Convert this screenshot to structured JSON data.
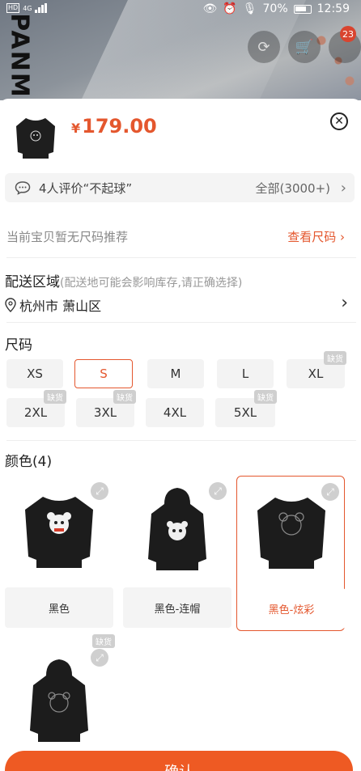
{
  "status_bar": {
    "hd": "HD",
    "network": "4G",
    "battery_percent": "70%",
    "time": "12:59"
  },
  "banner": {
    "brand_text": "PANM",
    "cart_badge": "23"
  },
  "product": {
    "currency": "¥",
    "price": "179.00"
  },
  "review": {
    "text": "4人评价“不起球”",
    "all_label": "全部(3000+)"
  },
  "size_recommend": {
    "notice": "当前宝贝暂无尺码推荐",
    "link": "查看尺码"
  },
  "shipping": {
    "title": "配送区域",
    "subtitle": "(配送地可能会影响库存,请正确选择)",
    "address": "杭州市 萧山区"
  },
  "sizes": {
    "title": "尺码",
    "out_of_stock_label": "缺货",
    "options": [
      {
        "label": "XS",
        "selected": false,
        "out_of_stock": false
      },
      {
        "label": "S",
        "selected": true,
        "out_of_stock": false
      },
      {
        "label": "M",
        "selected": false,
        "out_of_stock": false
      },
      {
        "label": "L",
        "selected": false,
        "out_of_stock": false
      },
      {
        "label": "XL",
        "selected": false,
        "out_of_stock": true
      },
      {
        "label": "2XL",
        "selected": false,
        "out_of_stock": true
      },
      {
        "label": "3XL",
        "selected": false,
        "out_of_stock": true
      },
      {
        "label": "4XL",
        "selected": false,
        "out_of_stock": false
      },
      {
        "label": "5XL",
        "selected": false,
        "out_of_stock": true
      }
    ]
  },
  "colors": {
    "title": "颜色(4)",
    "options": [
      {
        "label": "黑色",
        "selected": false,
        "out_of_stock": false
      },
      {
        "label": "黑色-连帽",
        "selected": false,
        "out_of_stock": false
      },
      {
        "label": "黑色-炫彩",
        "selected": true,
        "out_of_stock": false
      },
      {
        "label": "",
        "selected": false,
        "out_of_stock": true
      }
    ]
  },
  "confirm_button": "确认",
  "theme": {
    "accent": "#e4572e",
    "confirm_bg": "#ee5a23"
  }
}
